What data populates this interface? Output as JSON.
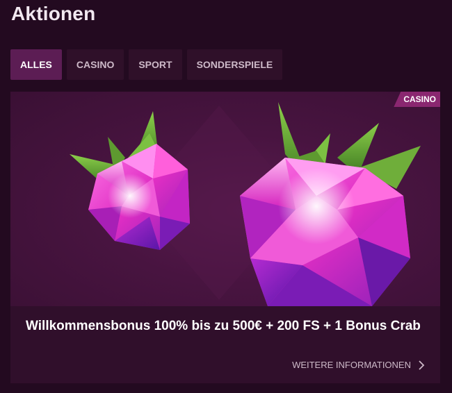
{
  "page": {
    "title": "Aktionen"
  },
  "tabs": [
    {
      "label": "ALLES",
      "active": true
    },
    {
      "label": "CASINO",
      "active": false
    },
    {
      "label": "SPORT",
      "active": false
    },
    {
      "label": "SONDERSPIELE",
      "active": false
    }
  ],
  "promo": {
    "category_badge": "CASINO",
    "title": "Willkommensbonus 100% bis zu 500€ + 200 FS + 1 Bonus Crab",
    "more_label": "WEITERE INFORMATIONEN",
    "image_icon": "raspberry-gem-icon",
    "more_icon": "chevron-right-icon"
  },
  "colors": {
    "background": "#230a20",
    "tab_active": "#5c1d54",
    "tab_inactive": "#2f1029",
    "badge": "#8a2770",
    "gem_pink": "#e02ec4",
    "leaf_green": "#6fae3a"
  }
}
